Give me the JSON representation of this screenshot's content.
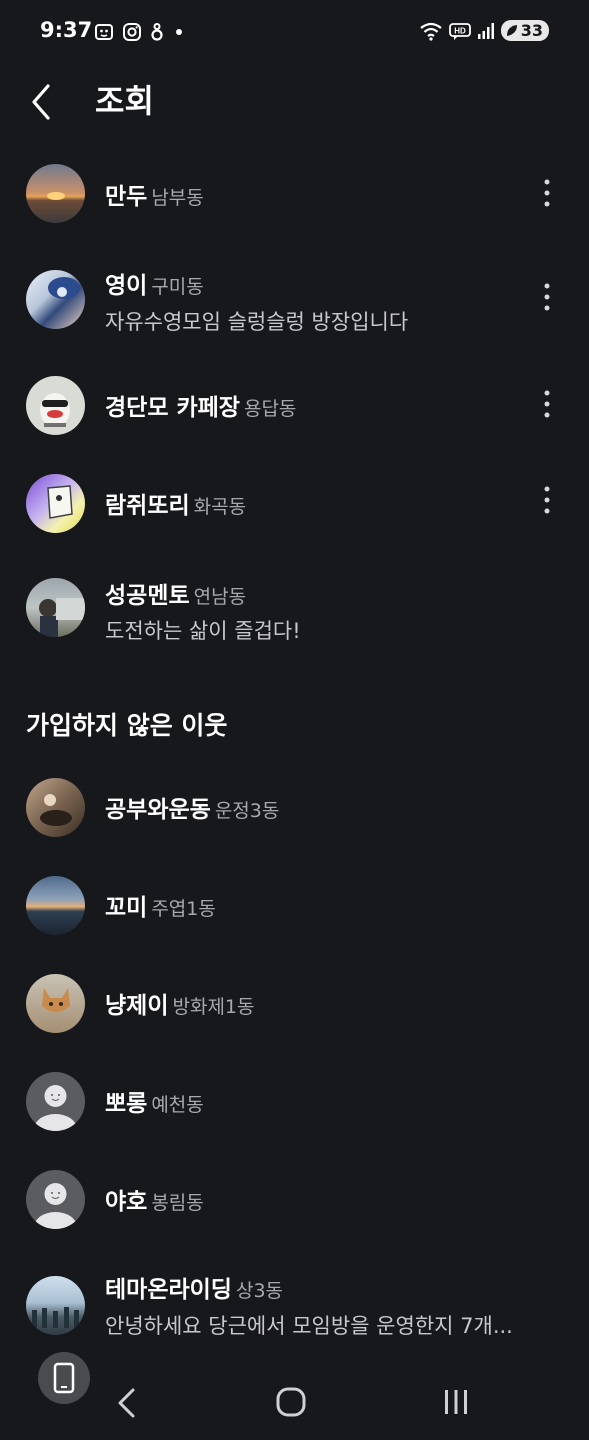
{
  "status": {
    "time": "9:37",
    "battery": "33"
  },
  "header": {
    "title": "조회",
    "back_icon": "chevron-left-icon"
  },
  "joined": [
    {
      "name": "만두",
      "area": "남부동",
      "bio": "",
      "avatar": "sunset-photo",
      "has_more": true
    },
    {
      "name": "영이",
      "area": "구미동",
      "bio": "자유수영모임 슬렁슬렁 방장입니다",
      "avatar": "swimmer-photo",
      "has_more": true
    },
    {
      "name": "경단모 카페장",
      "area": "용답동",
      "bio": "",
      "avatar": "character-photo",
      "has_more": true
    },
    {
      "name": "람쥐또리",
      "area": "화곡동",
      "bio": "",
      "avatar": "drawing-photo",
      "has_more": true
    },
    {
      "name": "성공멘토",
      "area": "연남동",
      "bio": "도전하는 삶이 즐겁다!",
      "avatar": "person-photo",
      "has_more": false
    }
  ],
  "not_joined_title": "가입하지 않은 이웃",
  "not_joined": [
    {
      "name": "공부와운동",
      "area": "운정3동",
      "bio": "",
      "avatar": "cafe-photo"
    },
    {
      "name": "꼬미",
      "area": "주엽1동",
      "bio": "",
      "avatar": "sea-photo"
    },
    {
      "name": "냥제이",
      "area": "방화제1동",
      "bio": "",
      "avatar": "cat-photo"
    },
    {
      "name": "뽀롱",
      "area": "예천동",
      "bio": "",
      "avatar": "default-avatar"
    },
    {
      "name": "야호",
      "area": "봉림동",
      "bio": "",
      "avatar": "default-avatar"
    },
    {
      "name": "테마온라이딩",
      "area": "상3동",
      "bio": "안녕하세요 당근에서 모임방을 운영한지 7개...",
      "avatar": "group-photo"
    }
  ],
  "colors": {
    "background": "#17181b",
    "secondary_text": "#a7a8ad"
  }
}
